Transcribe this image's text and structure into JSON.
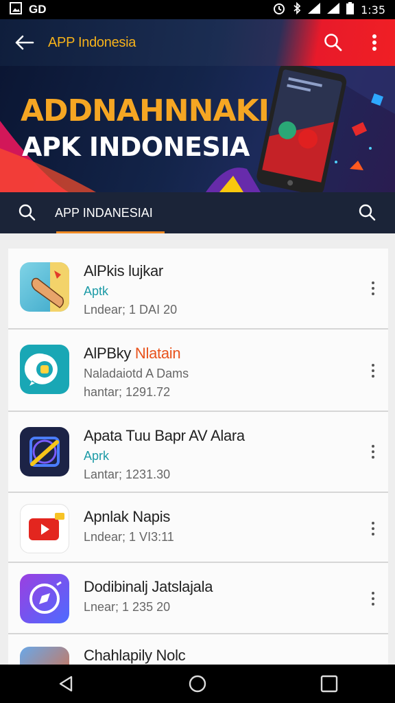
{
  "status_bar": {
    "carrier_text": "GD",
    "time": "1:35"
  },
  "app_bar": {
    "title": "APP Indonesia",
    "back_icon": "arrow-left-icon",
    "search_icon": "search-icon",
    "menu_icon": "more-vert-icon"
  },
  "banner": {
    "line1": "ADDNAHNNAKI",
    "line2": "APK INDONESIA"
  },
  "search_bar": {
    "label": "APP INDANESIAI"
  },
  "apps": [
    {
      "name": "AlPkis lujkar",
      "sub": "Aptk",
      "meta": "Lndear; 1 DAI 20",
      "icon": "finger-icon"
    },
    {
      "name": "AlPBky ",
      "name_highlight": "Nlatain",
      "sub": "Naladaiotd A Dams",
      "meta": "hantar; 1291.72",
      "icon": "chat-app-icon"
    },
    {
      "name": "Apata Tuu Bapr AV Alara",
      "sub": "Aprk",
      "meta": "Lantar; 1231.30",
      "icon": "pencil-square-icon"
    },
    {
      "name": "Apnlak Napis",
      "sub": "",
      "meta": "Lndear; 1 VI3:11",
      "icon": "video-play-icon"
    },
    {
      "name": "Dodibinalj Jatslajala",
      "sub": "",
      "meta": "Lnear; 1 235 20",
      "icon": "compass-icon"
    },
    {
      "name": "Chahlapily Nolc",
      "sub": "",
      "meta": "",
      "icon": "photo-app-icon"
    }
  ],
  "colors": {
    "accent_orange": "#f08a24",
    "title_yellow": "#f6b21a",
    "link_teal": "#1b9aa6",
    "brand_red": "#e81a2a"
  }
}
